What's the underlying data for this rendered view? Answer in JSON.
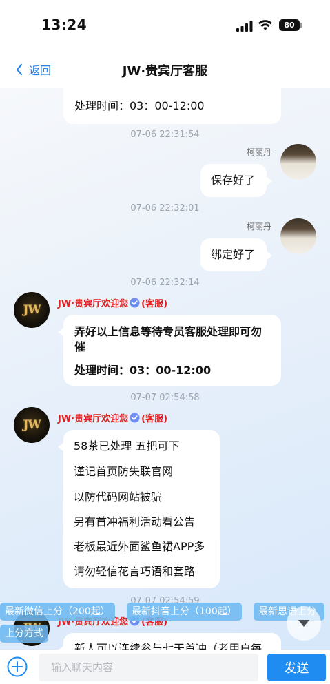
{
  "status_bar": {
    "time": "13:24",
    "battery_level": "80"
  },
  "nav": {
    "back_label": "返回",
    "title": "JW·贵宾厅客服"
  },
  "messages": {
    "m0": {
      "lines": [
        "处理时间：03：00-12:00"
      ]
    },
    "t1": "07-06 22:31:54",
    "m1": {
      "sender": "柯丽丹",
      "lines": [
        "保存好了"
      ]
    },
    "t2": "07-06 22:32:01",
    "m2": {
      "sender": "柯丽丹",
      "lines": [
        "绑定好了"
      ]
    },
    "t3": "07-06 22:32:14",
    "m3": {
      "sender": "JW·贵宾厅欢迎您",
      "role": "(客服)",
      "lines": [
        "弄好以上信息等待专员客服处理即可勿",
        "催",
        "处理时间：03：00-12:00"
      ]
    },
    "t4": "07-07 02:54:58",
    "m4": {
      "sender": "JW·贵宾厅欢迎您",
      "role": "(客服)",
      "lines": [
        "58茶已处理  五把可下",
        "谨记首页防失联官网",
        "以防代码网站被骗",
        "另有首冲福利活动看公告",
        "老板最近外面鲨鱼裙APP多",
        "请勿轻信花言巧语和套路"
      ]
    },
    "t5": "07-07 02:54:59",
    "m5": {
      "sender": "JW·贵宾厅欢迎您",
      "role": "(客服)",
      "lines": [
        "新人可以连续参与七天首冲（老用户每"
      ]
    }
  },
  "quick_tags": [
    "最新微信上分（200起）",
    "最新抖音上分（100起）",
    "最新思语上分",
    "上分方式"
  ],
  "input": {
    "placeholder": "输入聊天内容",
    "value": ""
  },
  "send_label": "发送",
  "colors": {
    "accent": "#1f8cf2",
    "service_name": "#e02020",
    "quick_tag": "#6eb8f0"
  }
}
